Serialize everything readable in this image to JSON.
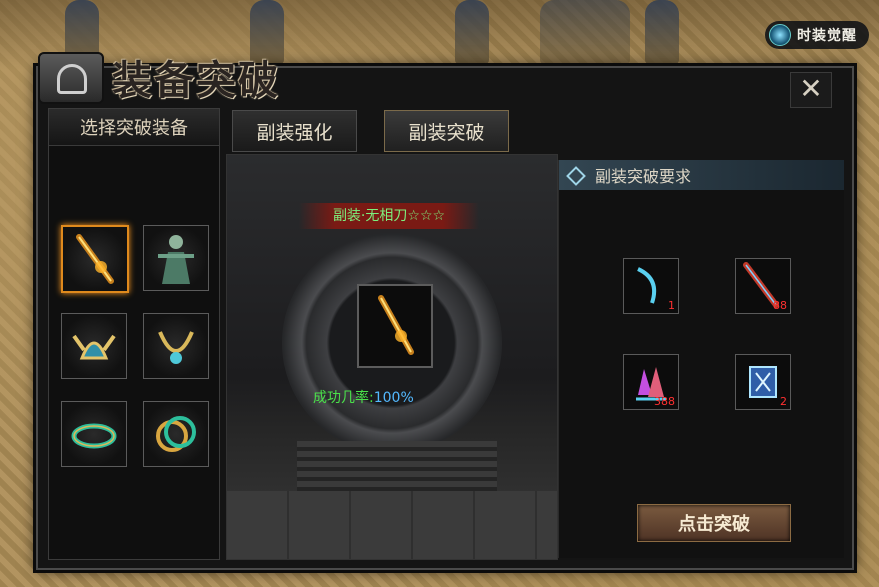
{
  "awaken_label": "时装觉醒",
  "title": "装备突破",
  "left_panel": {
    "header": "选择突破装备"
  },
  "tabs": [
    {
      "label": "副装强化",
      "active": false
    },
    {
      "label": "副装突破",
      "active": true
    }
  ],
  "center": {
    "item_name": "副装·无相刀☆☆☆",
    "success_label": "成功几率:",
    "success_value": "100%"
  },
  "requirements": {
    "header": "副装突破要求",
    "items": [
      {
        "icon": "blade-icon",
        "count": "1"
      },
      {
        "icon": "spear-icon",
        "count": "88"
      },
      {
        "icon": "crystal-icon",
        "count": "388"
      },
      {
        "icon": "rune-stone-icon",
        "count": "2"
      }
    ]
  },
  "action_button": "点击突破",
  "colors": {
    "accent": "#e08a1d",
    "success": "#4ae04a",
    "rate": "#53b9ff",
    "count": "#ff3030"
  }
}
